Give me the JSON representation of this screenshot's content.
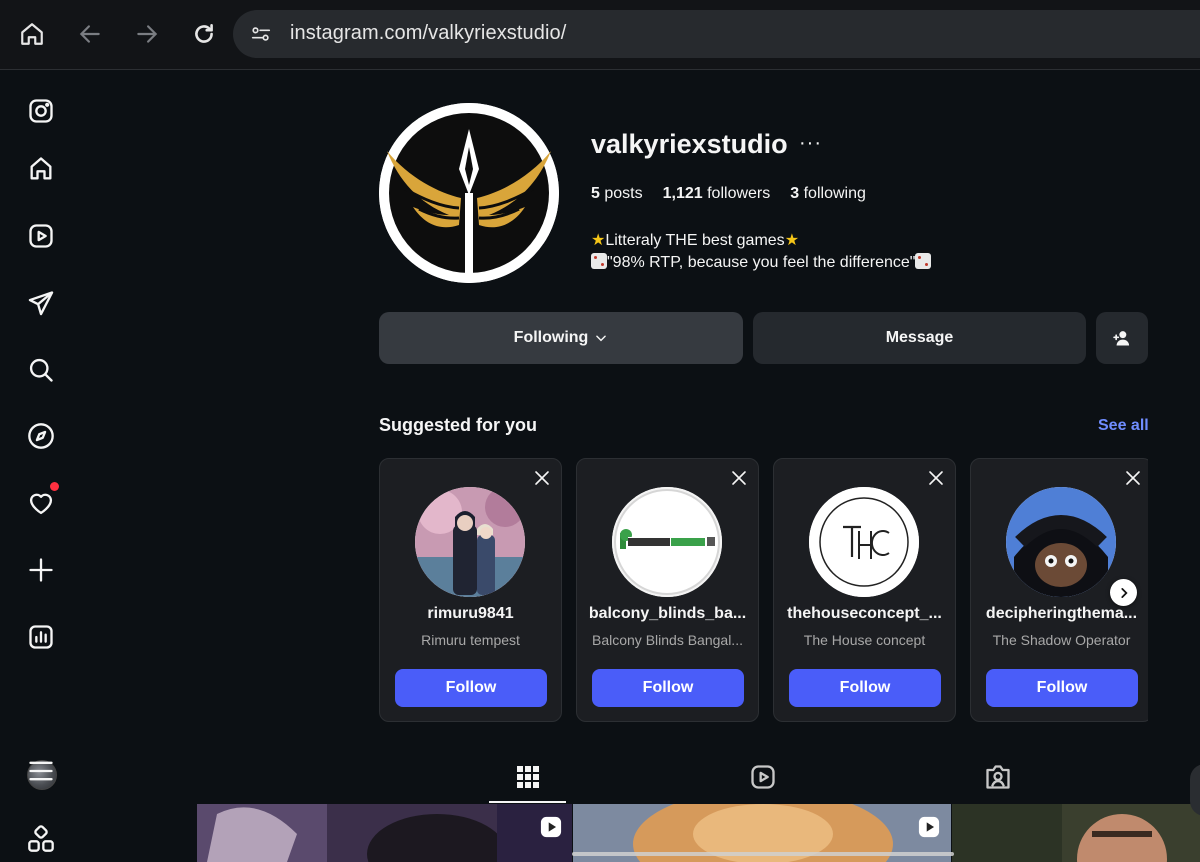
{
  "browser": {
    "url": "instagram.com/valkyriexstudio/"
  },
  "sidebar": {
    "items": [
      {
        "name": "instagram-logo-icon"
      },
      {
        "name": "home-icon"
      },
      {
        "name": "reels-icon"
      },
      {
        "name": "messages-icon"
      },
      {
        "name": "search-icon"
      },
      {
        "name": "explore-icon"
      },
      {
        "name": "notifications-icon",
        "badge": true
      },
      {
        "name": "create-icon"
      },
      {
        "name": "insights-icon"
      },
      {
        "name": "profile-avatar"
      },
      {
        "name": "menu-icon"
      },
      {
        "name": "more-apps-icon"
      }
    ]
  },
  "profile": {
    "username": "valkyriexstudio",
    "more": "···",
    "posts_count": "5",
    "posts_label": "posts",
    "followers_count": "1,121",
    "followers_label": "followers",
    "following_count": "3",
    "following_label": "following",
    "bio_line1": "Litteraly THE best games",
    "bio_line2": "\"98% RTP, because you feel the difference\""
  },
  "actions": {
    "following_label": "Following",
    "message_label": "Message"
  },
  "suggested": {
    "title": "Suggested for you",
    "see_all": "See all",
    "cards": [
      {
        "username": "rimuru9841",
        "name": "Rimuru tempest",
        "button": "Follow"
      },
      {
        "username": "balcony_blinds_ba...",
        "name": "Balcony Blinds Bangal...",
        "button": "Follow"
      },
      {
        "username": "thehouseconcept_...",
        "name": "The House concept",
        "button": "Follow"
      },
      {
        "username": "decipheringthema...",
        "name": "The Shadow Operator",
        "button": "Follow"
      }
    ]
  },
  "tabs": [
    {
      "name": "posts-grid-icon",
      "active": true
    },
    {
      "name": "reels-tab-icon",
      "active": false
    },
    {
      "name": "tagged-tab-icon",
      "active": false
    }
  ],
  "colors": {
    "background": "#0c1014",
    "accent_blue": "#4a5df9",
    "link_blue": "#708dff",
    "notification_red": "#ff3040"
  }
}
